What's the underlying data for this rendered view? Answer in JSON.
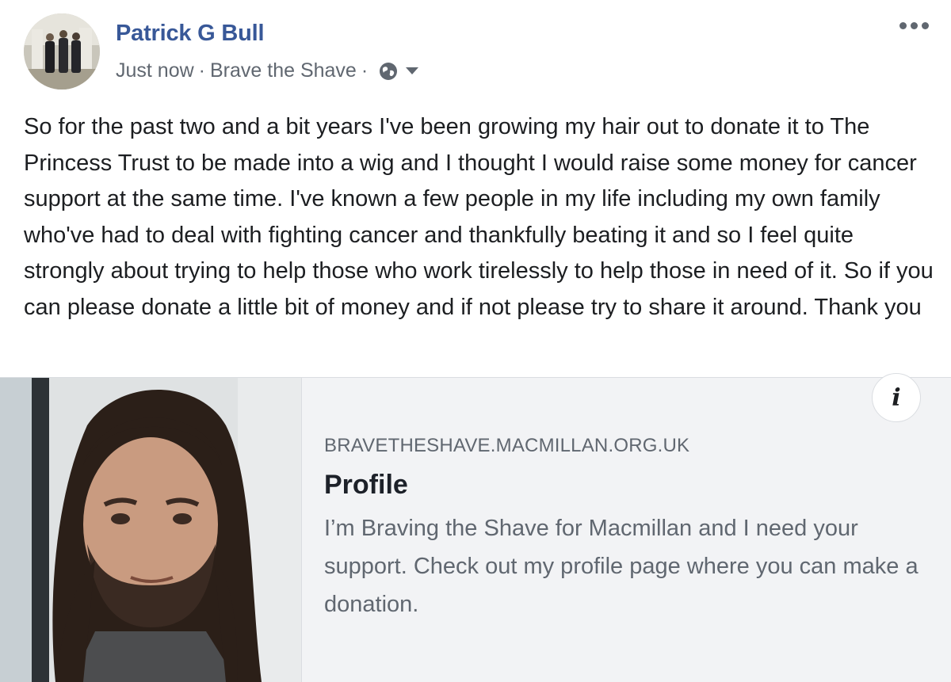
{
  "post": {
    "author": "Patrick G Bull",
    "timestamp": "Just now",
    "separator": "·",
    "group": "Brave the Shave",
    "privacy_icon": "globe-icon",
    "menu_icon": "more-options-icon",
    "body": "So for the past two and a bit years I've been growing my hair out to donate it to The Princess Trust to be made into a wig and I thought I would raise some money for cancer support at the same time. I've known a few people in my life including my own family who've had to deal with fighting cancer and thankfully beating it and so I feel quite strongly about trying to help those who work tirelessly to help those in need of it. So if you can please donate a little bit of money and if not please try to share it around. Thank you"
  },
  "link_card": {
    "domain": "BRAVETHESHAVE.MACMILLAN.ORG.UK",
    "title": "Profile",
    "description": "I’m Braving the Shave for Macmillan and I need your support. Check out my profile page where you can make a donation.",
    "info_label": "i"
  },
  "colors": {
    "author_link": "#385898",
    "secondary_text": "#606770",
    "card_background": "#f2f3f5"
  }
}
